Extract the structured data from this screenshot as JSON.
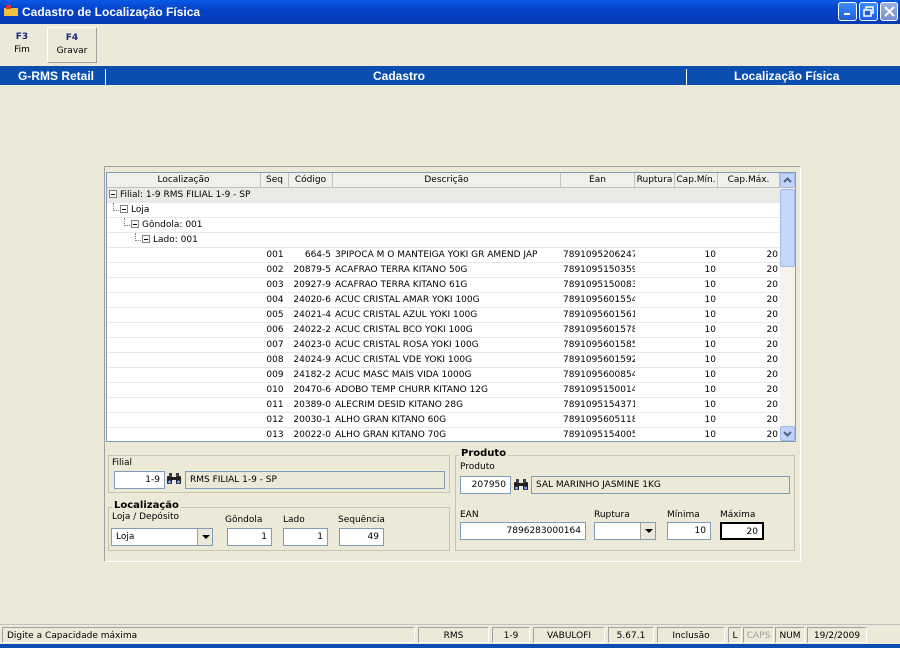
{
  "window": {
    "title": "Cadastro de Localização Física"
  },
  "toolbar": {
    "f3": {
      "key": "F3",
      "label": "Fim"
    },
    "f4": {
      "key": "F4",
      "label": "Gravar"
    }
  },
  "header": {
    "left": "G-RMS Retail",
    "center": "Cadastro",
    "right": "Localização Física"
  },
  "grid": {
    "columns": {
      "localizacao": "Localização",
      "seq": "Seq",
      "codigo": "Código",
      "descricao": "Descrição",
      "ean": "Ean",
      "ruptura": "Ruptura",
      "capmin": "Cap.Mín.",
      "capmax": "Cap.Máx."
    },
    "tree": {
      "filial": "Filial: 1-9  RMS FILIAL 1-9 - SP",
      "loja": "Loja",
      "gondola": "Gôndola: 001",
      "lado": "Lado: 001"
    },
    "rows": [
      {
        "seq": "001",
        "codigo": "664-5",
        "descricao": "3PIPOCA M O MANTEIGA YOKI GR AMEND JAP",
        "ean": "7891095206247",
        "ruptura": "",
        "min": "10",
        "max": "20"
      },
      {
        "seq": "002",
        "codigo": "20879-5",
        "descricao": "ACAFRAO TERRA KITANO 50G",
        "ean": "7891095150359",
        "ruptura": "",
        "min": "10",
        "max": "20"
      },
      {
        "seq": "003",
        "codigo": "20927-9",
        "descricao": "ACAFRAO TERRA KITANO 61G",
        "ean": "7891095150083",
        "ruptura": "",
        "min": "10",
        "max": "20"
      },
      {
        "seq": "004",
        "codigo": "24020-6",
        "descricao": "ACUC CRISTAL AMAR YOKI 100G",
        "ean": "7891095601554",
        "ruptura": "",
        "min": "10",
        "max": "20"
      },
      {
        "seq": "005",
        "codigo": "24021-4",
        "descricao": "ACUC CRISTAL AZUL YOKI 100G",
        "ean": "7891095601561",
        "ruptura": "",
        "min": "10",
        "max": "20"
      },
      {
        "seq": "006",
        "codigo": "24022-2",
        "descricao": "ACUC CRISTAL BCO YOKI 100G",
        "ean": "7891095601578",
        "ruptura": "",
        "min": "10",
        "max": "20"
      },
      {
        "seq": "007",
        "codigo": "24023-0",
        "descricao": "ACUC CRISTAL ROSA YOKI 100G",
        "ean": "7891095601585",
        "ruptura": "",
        "min": "10",
        "max": "20"
      },
      {
        "seq": "008",
        "codigo": "24024-9",
        "descricao": "ACUC CRISTAL VDE YOKI 100G",
        "ean": "7891095601592",
        "ruptura": "",
        "min": "10",
        "max": "20"
      },
      {
        "seq": "009",
        "codigo": "24182-2",
        "descricao": "ACUC MASC MAIS VIDA 1000G",
        "ean": "7891095600854",
        "ruptura": "",
        "min": "10",
        "max": "20"
      },
      {
        "seq": "010",
        "codigo": "20470-6",
        "descricao": "ADOBO TEMP CHURR KITANO 12G",
        "ean": "7891095150014",
        "ruptura": "",
        "min": "10",
        "max": "20"
      },
      {
        "seq": "011",
        "codigo": "20389-0",
        "descricao": "ALECRIM DESID KITANO 28G",
        "ean": "7891095154371",
        "ruptura": "",
        "min": "10",
        "max": "20"
      },
      {
        "seq": "012",
        "codigo": "20030-1",
        "descricao": "ALHO GRAN KITANO 60G",
        "ean": "7891095605118",
        "ruptura": "",
        "min": "10",
        "max": "20"
      },
      {
        "seq": "013",
        "codigo": "20022-0",
        "descricao": "ALHO GRAN KITANO 70G",
        "ean": "7891095154005",
        "ruptura": "",
        "min": "10",
        "max": "20"
      }
    ]
  },
  "filial": {
    "label": "Filial",
    "code": "1-9",
    "name": "RMS FILIAL 1-9 - SP"
  },
  "localizacao": {
    "title": "Localização",
    "loja_label": "Loja / Depósito",
    "loja_value": "Loja",
    "gondola_label": "Gôndola",
    "gondola_value": "1",
    "lado_label": "Lado",
    "lado_value": "1",
    "sequencia_label": "Sequência",
    "sequencia_value": "49"
  },
  "produto": {
    "title": "Produto",
    "produto_label": "Produto",
    "code": "207950",
    "name": "SAL MARINHO JASMINE 1KG",
    "ean_label": "EAN",
    "ean_value": "7896283000164",
    "ruptura_label": "Ruptura",
    "ruptura_value": "",
    "minima_label": "Mínima",
    "minima_value": "10",
    "maxima_label": "Máxima",
    "maxima_value": "20"
  },
  "status": {
    "message": "Digite a Capacidade máxima",
    "system": "RMS",
    "filial": "1-9",
    "user": "VABULOFI",
    "version": "5.67.1",
    "mode": "Inclusão",
    "l": "L",
    "caps": "CAPS",
    "num": "NUM",
    "date": "19/2/2009"
  }
}
